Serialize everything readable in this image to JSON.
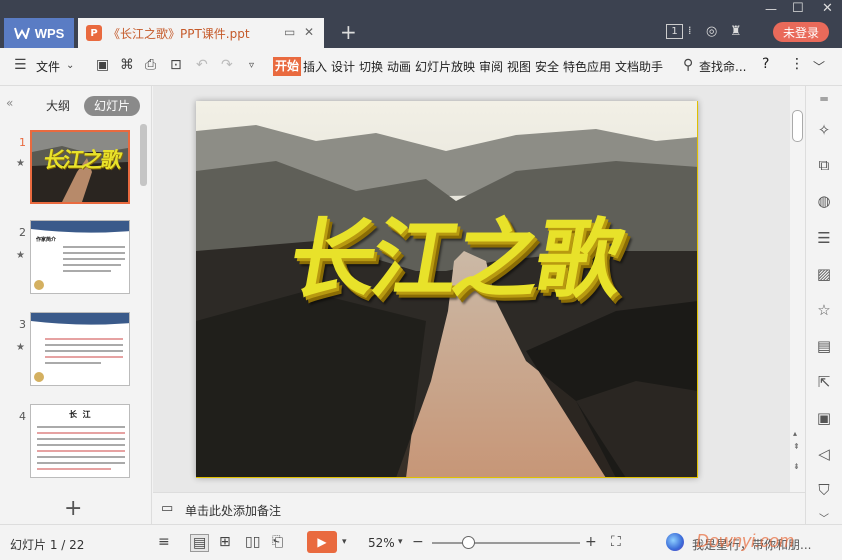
{
  "titlebar": {
    "app_tab": "WPS",
    "doc_tab": "《长江之歌》PPT课件.ppt",
    "doc_icon_letter": "P",
    "new_tab_icon": "plus-icon",
    "page_count_badge": "1",
    "login_button": "未登录"
  },
  "toolbar": {
    "file_menu": "文件",
    "tabs": [
      "开始",
      "插入",
      "设计",
      "切换",
      "动画",
      "幻灯片放映",
      "审阅",
      "视图",
      "安全",
      "特色应用",
      "文档助手"
    ],
    "search": "查找命...",
    "help": "?",
    "more": "⋮"
  },
  "leftpane": {
    "tab_outline": "大纲",
    "tab_slides": "幻灯片",
    "thumbs": [
      {
        "num": "1",
        "title": "长江之歌"
      },
      {
        "num": "2",
        "title": "作家简介"
      },
      {
        "num": "3",
        "title": ""
      },
      {
        "num": "4",
        "title": "长  江"
      }
    ]
  },
  "slide": {
    "title": "长江之歌"
  },
  "notes": {
    "placeholder": "单击此处添加备注"
  },
  "statusbar": {
    "slide_counter": "幻灯片 1 / 22",
    "zoom": "52%",
    "promo": "我是星行，带你和朋...",
    "watermark": "Downyi.com"
  },
  "colors": {
    "accent": "#e96a3f",
    "titlebar_bg": "#3c4250",
    "wps_tab": "#5a7cc4",
    "login": "#e96a5a"
  }
}
